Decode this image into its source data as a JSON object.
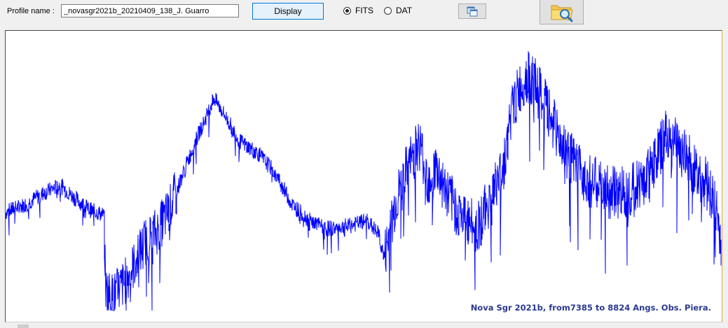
{
  "toolbar": {
    "profile_label": "Profile name :",
    "profile_value": "_novasgr2021b_20210409_138_J. Guarro",
    "display_label": "Display",
    "radio_fits_label": "FITS",
    "radio_dat_label": "DAT",
    "selected_format": "FITS",
    "copy_icon": "copy-windows-icon",
    "open_icon": "folder-search-icon"
  },
  "plot": {
    "caption": "Nova Sgr 2021b, from7385 to 8824 Angs. Obs. Piera.",
    "line_color": "#0000ff",
    "caption_color": "#2b3990"
  },
  "chart_data": {
    "type": "line",
    "x_range": [
      7385,
      8824
    ],
    "x_unit": "Angs.",
    "axes_visible": false,
    "grid": false,
    "series": [
      {
        "envelope": [
          [
            7385,
            0.36
          ],
          [
            7420,
            0.39
          ],
          [
            7450,
            0.43
          ],
          [
            7480,
            0.46
          ],
          [
            7500,
            0.42
          ],
          [
            7530,
            0.37
          ],
          [
            7555,
            0.35
          ],
          [
            7558,
            0.08
          ],
          [
            7570,
            0.05
          ],
          [
            7590,
            0.1
          ],
          [
            7610,
            0.18
          ],
          [
            7625,
            0.25
          ],
          [
            7650,
            0.3
          ],
          [
            7670,
            0.38
          ],
          [
            7695,
            0.52
          ],
          [
            7715,
            0.63
          ],
          [
            7730,
            0.7
          ],
          [
            7745,
            0.78
          ],
          [
            7760,
            0.73
          ],
          [
            7790,
            0.62
          ],
          [
            7820,
            0.58
          ],
          [
            7845,
            0.52
          ],
          [
            7865,
            0.45
          ],
          [
            7880,
            0.39
          ],
          [
            7910,
            0.33
          ],
          [
            7940,
            0.3
          ],
          [
            7980,
            0.31
          ],
          [
            8010,
            0.33
          ],
          [
            8030,
            0.28
          ],
          [
            8040,
            0.19
          ],
          [
            8060,
            0.4
          ],
          [
            8080,
            0.52
          ],
          [
            8100,
            0.62
          ],
          [
            8115,
            0.48
          ],
          [
            8130,
            0.52
          ],
          [
            8150,
            0.42
          ],
          [
            8175,
            0.34
          ],
          [
            8200,
            0.3
          ],
          [
            8225,
            0.42
          ],
          [
            8245,
            0.52
          ],
          [
            8262,
            0.75
          ],
          [
            8285,
            0.86
          ],
          [
            8300,
            0.83
          ],
          [
            8320,
            0.74
          ],
          [
            8345,
            0.62
          ],
          [
            8370,
            0.53
          ],
          [
            8400,
            0.47
          ],
          [
            8430,
            0.43
          ],
          [
            8460,
            0.44
          ],
          [
            8490,
            0.48
          ],
          [
            8510,
            0.56
          ],
          [
            8530,
            0.65
          ],
          [
            8550,
            0.6
          ],
          [
            8575,
            0.52
          ],
          [
            8600,
            0.46
          ],
          [
            8615,
            0.35
          ],
          [
            8622,
            0.25
          ]
        ]
      }
    ]
  }
}
